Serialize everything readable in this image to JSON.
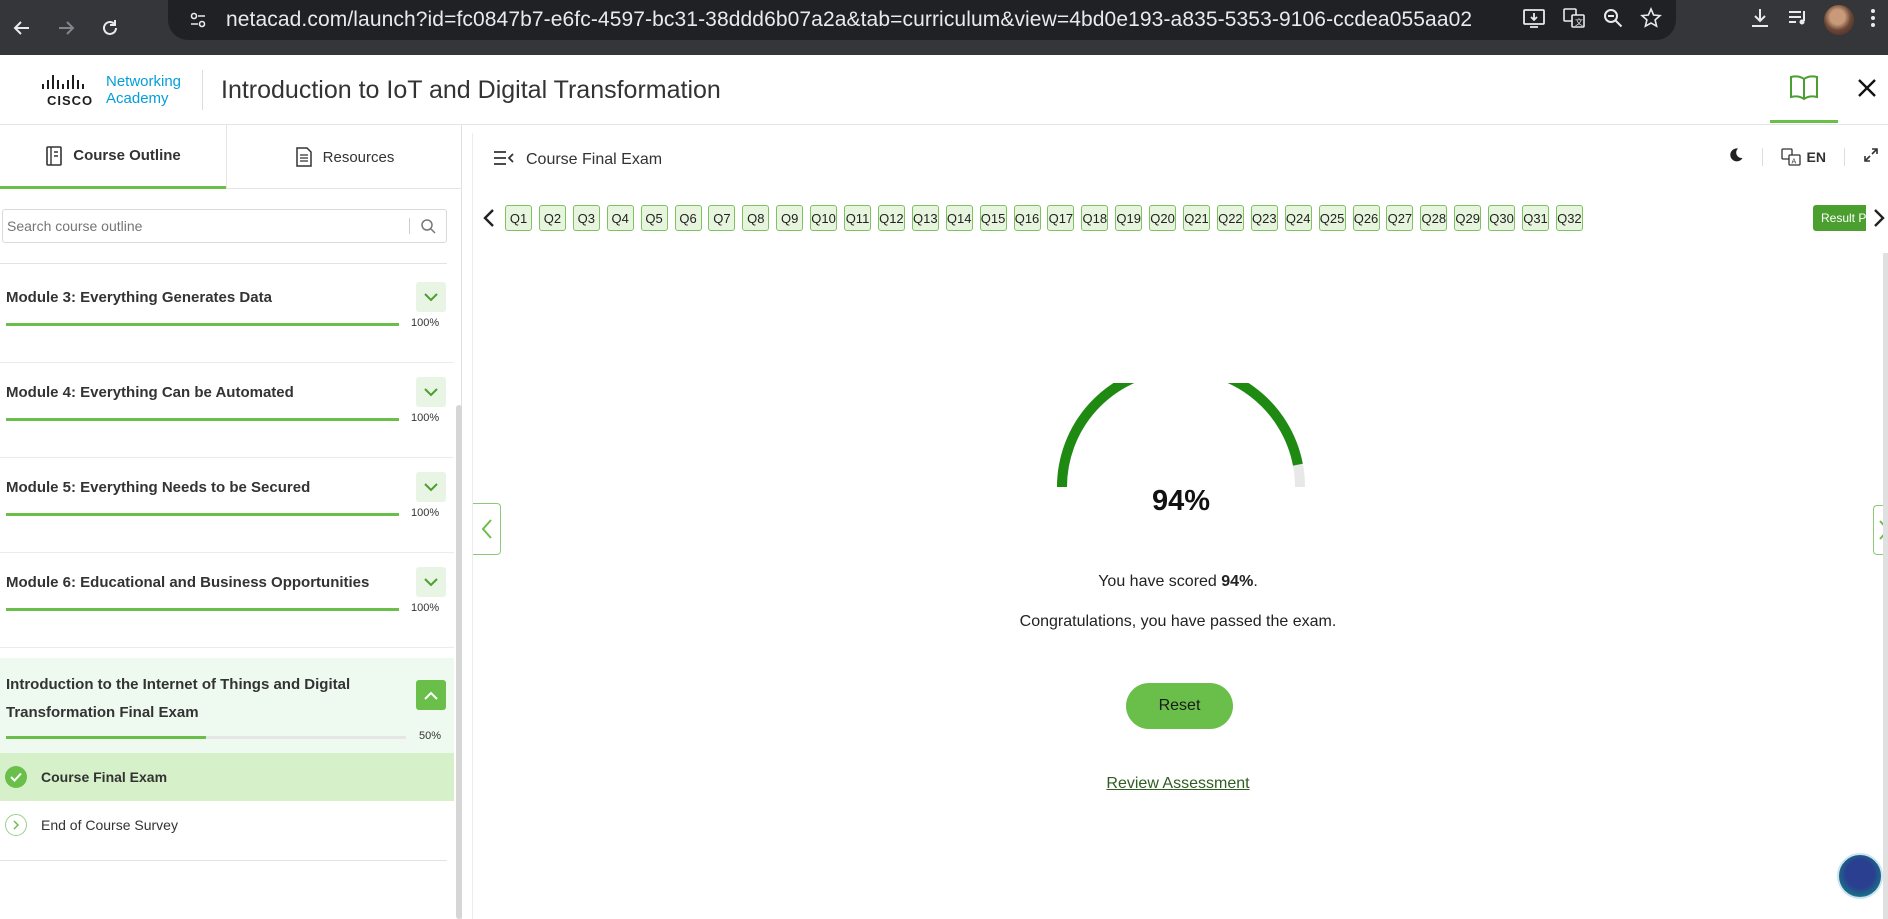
{
  "browser": {
    "url": "netacad.com/launch?id=fc0847b7-e6fc-4597-bc31-38ddd6b07a2a&tab=curriculum&view=4bd0e193-a835-5353-9106-ccdea055aa02"
  },
  "header": {
    "logo_cisco": "CISCO",
    "logo_academy_line1": "Networking",
    "logo_academy_line2": "Academy",
    "course_title": "Introduction to IoT and Digital Transformation"
  },
  "sidebar": {
    "tabs": [
      {
        "label": "Course Outline"
      },
      {
        "label": "Resources"
      }
    ],
    "search_placeholder": "Search course outline",
    "modules": [
      {
        "title": "Module 3: Everything Generates Data",
        "progress": 100,
        "progress_label": "100%"
      },
      {
        "title": "Module 4: Everything Can be Automated",
        "progress": 100,
        "progress_label": "100%"
      },
      {
        "title": "Module 5: Everything Needs to be Secured",
        "progress": 100,
        "progress_label": "100%"
      },
      {
        "title": "Module 6: Educational and Business Opportunities",
        "progress": 100,
        "progress_label": "100%"
      }
    ],
    "final_module": {
      "title": "Introduction to the Internet of Things and Digital Transformation Final Exam",
      "progress": 50,
      "progress_label": "50%",
      "items": [
        {
          "label": "Course Final Exam",
          "status": "done"
        },
        {
          "label": "End of Course Survey",
          "status": "open"
        }
      ]
    }
  },
  "main": {
    "exam_title": "Course Final Exam",
    "language": "EN",
    "questions": [
      "Q1",
      "Q2",
      "Q3",
      "Q4",
      "Q5",
      "Q6",
      "Q7",
      "Q8",
      "Q9",
      "Q10",
      "Q11",
      "Q12",
      "Q13",
      "Q14",
      "Q15",
      "Q16",
      "Q17",
      "Q18",
      "Q19",
      "Q20",
      "Q21",
      "Q22",
      "Q23",
      "Q24",
      "Q25",
      "Q26",
      "Q27",
      "Q28",
      "Q29",
      "Q30",
      "Q31",
      "Q32"
    ],
    "result_tab_label": "Result P",
    "score": 94,
    "score_label": "94%",
    "score_prefix": "You have scored ",
    "score_suffix": ".",
    "congrats": "Congratulations, you have passed the exam.",
    "reset_label": "Reset",
    "review_label": "Review Assessment"
  },
  "colors": {
    "accent": "#6abf4b",
    "gauge_fill": "#1e8a12",
    "gauge_track": "#e8e8e8",
    "chrome": "#35363a"
  }
}
